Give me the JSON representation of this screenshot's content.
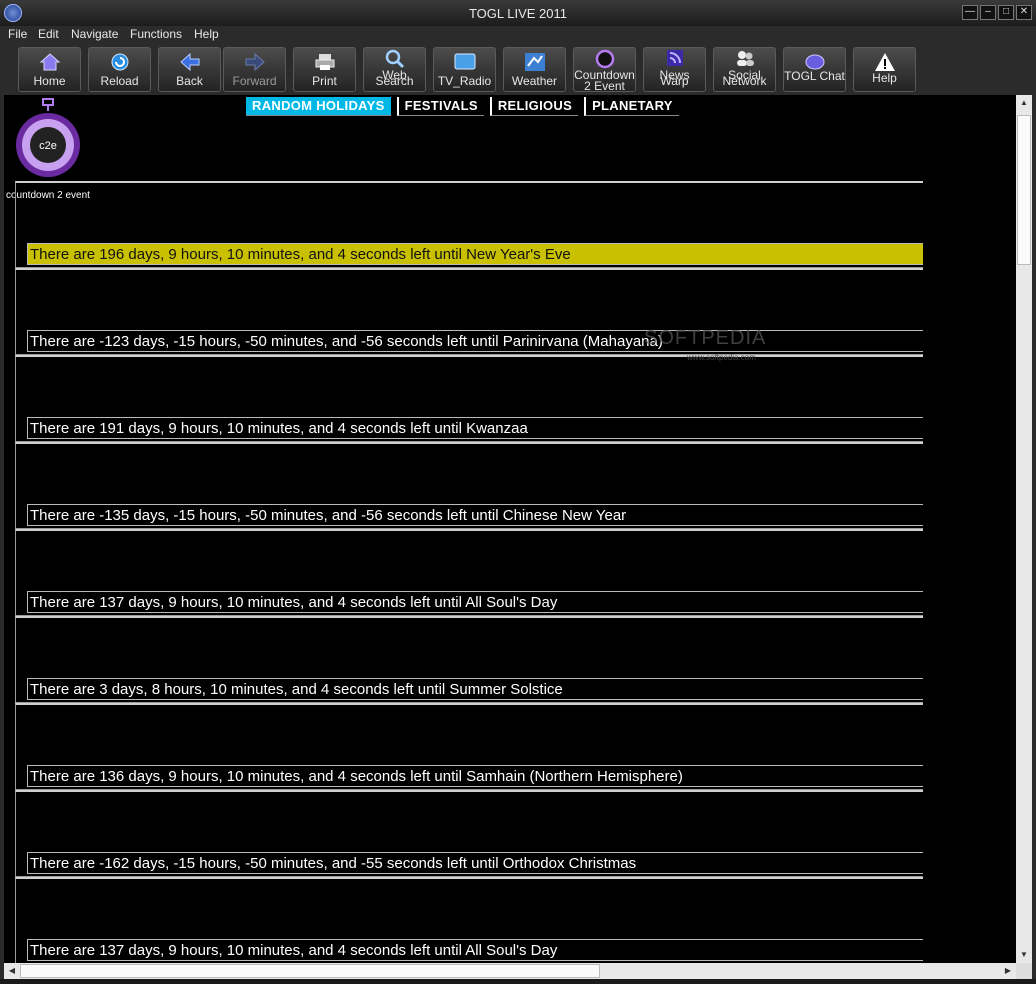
{
  "window": {
    "title": "TOGL LIVE 2011",
    "buttons": [
      "―",
      "–",
      "□",
      "✕"
    ]
  },
  "menu": [
    "File",
    "Edit",
    "Navigate",
    "Functions",
    "Help"
  ],
  "toolbar": [
    {
      "label": "Home",
      "icon": "home-icon"
    },
    {
      "label": "Reload",
      "icon": "reload-icon"
    },
    {
      "label": "Back",
      "icon": "back-arrow-icon"
    },
    {
      "label": "Forward",
      "icon": "forward-arrow-icon"
    },
    {
      "label": "Print",
      "icon": "printer-icon"
    },
    {
      "label": "Web",
      "label2": "Search",
      "icon": "search-icon"
    },
    {
      "label": "TV_Radio",
      "icon": "tv-icon"
    },
    {
      "label": "Weather",
      "icon": "weather-icon"
    },
    {
      "label": "Countdown",
      "label2": "2 Event",
      "icon": "countdown-icon"
    },
    {
      "label": "News",
      "label2": "Warp",
      "icon": "rss-icon"
    },
    {
      "label": "Social",
      "label2": "Network",
      "icon": "people-icon"
    },
    {
      "label": "TOGL Chat",
      "icon": "chat-icon"
    },
    {
      "label": "Help",
      "icon": "warning-icon"
    }
  ],
  "tabs": [
    "RANDOM HOLIDAYS",
    "FESTIVALS",
    "RELIGIOUS",
    "PLANETARY"
  ],
  "active_tab": 0,
  "logo": {
    "text": "c2e",
    "caption": "countdown 2 event"
  },
  "events": [
    "There are 196 days, 9 hours, 10 minutes, and 4 seconds left until New Year's Eve",
    "There are -123 days, -15 hours, -50 minutes, and -56 seconds left until Parinirvana (Mahayana)",
    "There are 191 days, 9 hours, 10 minutes, and 4 seconds left until Kwanzaa",
    "There are -135 days, -15 hours, -50 minutes, and -56 seconds left until Chinese New Year",
    "There are 137 days, 9 hours, 10 minutes, and 4 seconds left until All Soul's Day",
    "There are 3 days, 8 hours, 10 minutes, and 4 seconds left until Summer Solstice",
    "There are 136 days, 9 hours, 10 minutes, and 4 seconds left until Samhain (Northern Hemisphere)",
    "There are -162 days, -15 hours, -50 minutes, and -55 seconds left until Orthodox Christmas",
    "There are 137 days, 9 hours, 10 minutes, and 4 seconds left until All Soul's Day"
  ],
  "highlight_index": 0,
  "watermark": {
    "text": "SOFTPEDIA",
    "sub": "www.softpedia.com"
  },
  "colors": {
    "highlight": "#c9c100",
    "active_tab": "#00b8e6"
  }
}
